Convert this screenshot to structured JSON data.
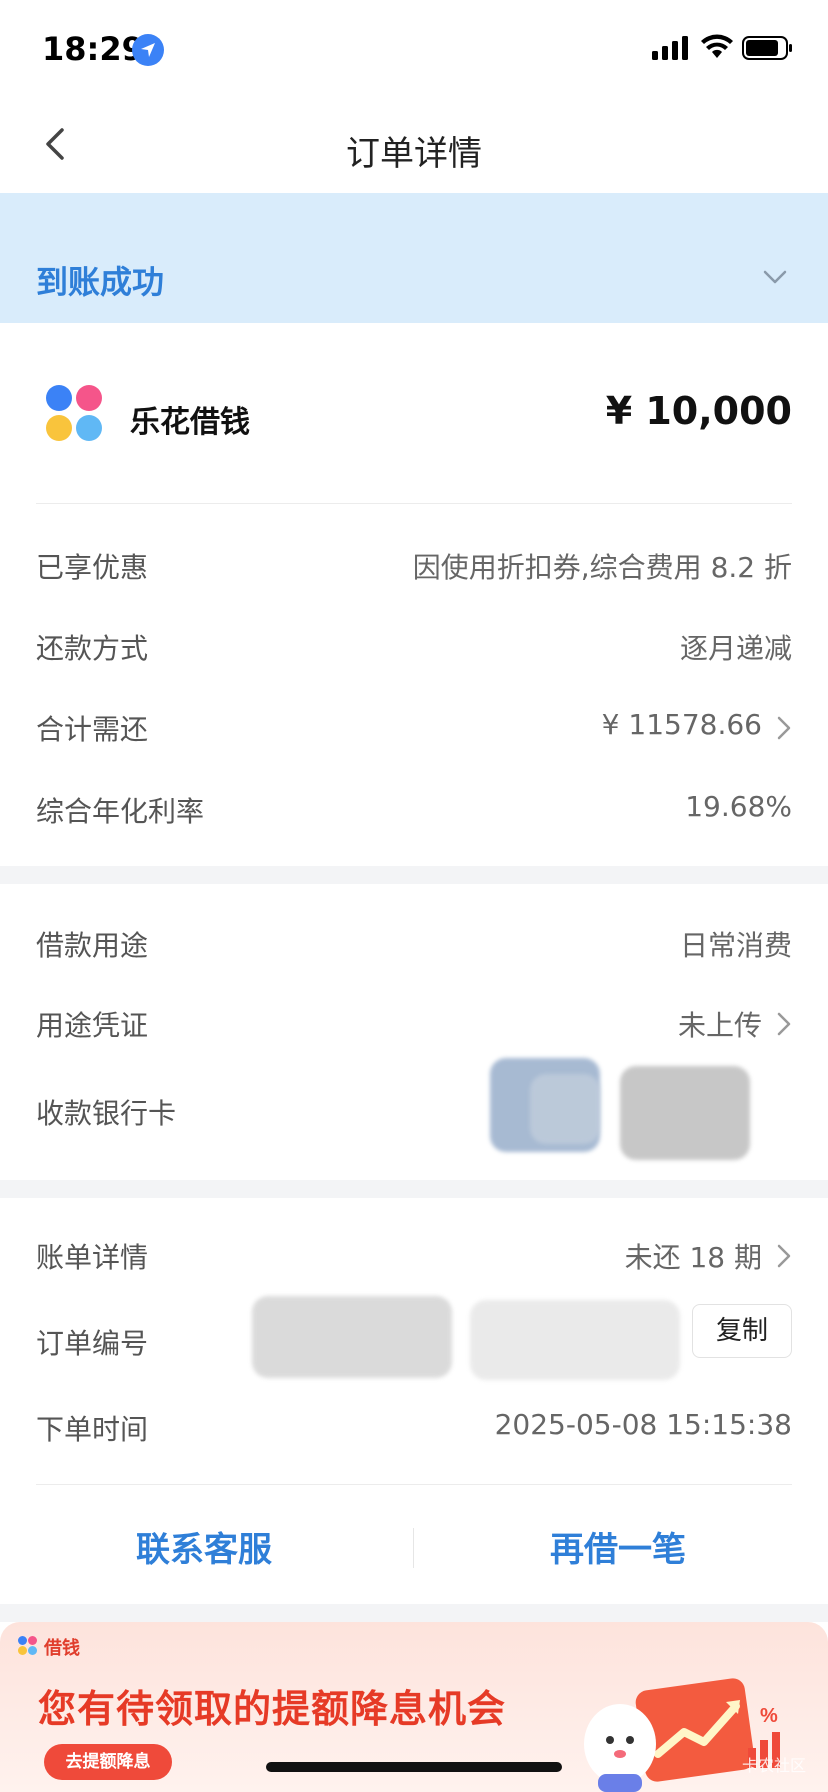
{
  "status_bar": {
    "time": "18:29"
  },
  "nav": {
    "title": "订单详情"
  },
  "banner": {
    "status": "到账成功"
  },
  "product": {
    "name": "乐花借钱",
    "amount": "¥ 10,000"
  },
  "details": [
    {
      "label": "已享优惠",
      "value": "因使用折扣券,综合费用 8.2 折"
    },
    {
      "label": "还款方式",
      "value": "逐月递减"
    },
    {
      "label": "合计需还",
      "value": "¥ 11578.66"
    },
    {
      "label": "综合年化利率",
      "value": "19.68%"
    }
  ],
  "loan": [
    {
      "label": "借款用途",
      "value": "日常消费"
    },
    {
      "label": "用途凭证",
      "value": "未上传"
    },
    {
      "label": "收款银行卡",
      "value": ""
    }
  ],
  "order": [
    {
      "label": "账单详情",
      "value": "未还 18 期"
    },
    {
      "label": "订单编号",
      "value": ""
    },
    {
      "label": "下单时间",
      "value": "2025-05-08 15:15:38"
    }
  ],
  "copy_label": "复制",
  "actions": {
    "contact": "联系客服",
    "borrow_again": "再借一笔"
  },
  "promo": {
    "tag": "借钱",
    "headline": "您有待领取的提额降息机会",
    "cta": "去提额降息",
    "watermark": "卡农社区"
  },
  "colors": {
    "accent": "#2f7fd8",
    "banner_bg": "#d9ecfb",
    "promo_red": "#e63a26"
  }
}
